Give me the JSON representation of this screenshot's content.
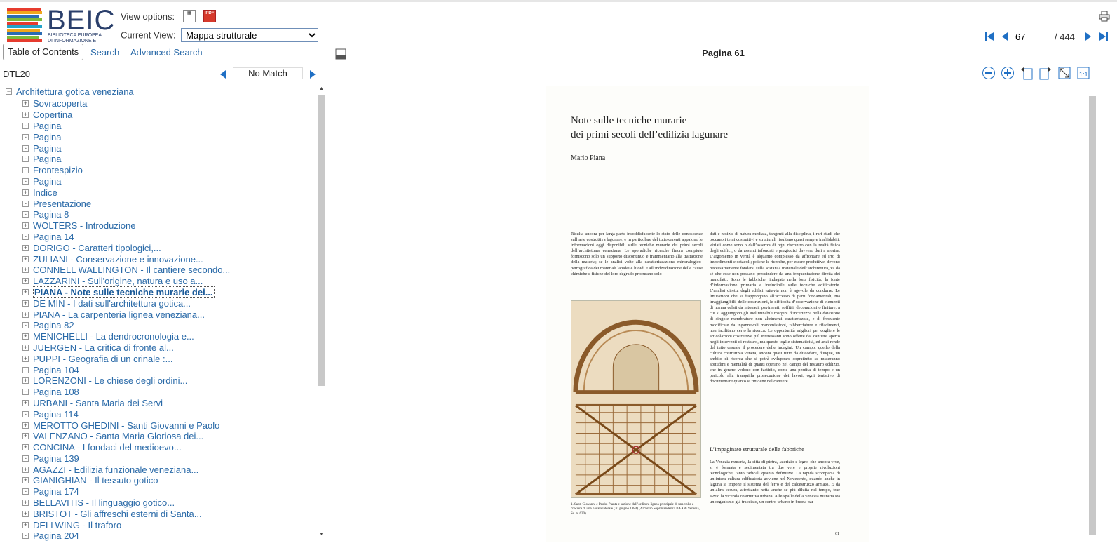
{
  "header": {
    "logo_word": "BEIC",
    "logo_sub_1": "BIBLIOTECA EUROPEA",
    "logo_sub_2": "DI INFORMAZIONE E CULTURA",
    "view_options_label": "View options:",
    "current_view_label": "Current View:",
    "current_view_value": "Mappa strutturale"
  },
  "pager": {
    "current_page": "67",
    "total": "/ 444"
  },
  "tabs": {
    "toc": "Table of Contents",
    "search": "Search",
    "advanced": "Advanced Search"
  },
  "doc_title": "Pagina 61",
  "toc_bar": {
    "id": "DTL20",
    "match": "No Match"
  },
  "tree": {
    "root": "Architettura gotica veneziana",
    "items": [
      {
        "label": "Sovracoperta",
        "exp": "+"
      },
      {
        "label": "Copertina",
        "exp": "+"
      },
      {
        "label": "Pagina",
        "exp": "-"
      },
      {
        "label": "Pagina",
        "exp": "-"
      },
      {
        "label": "Pagina",
        "exp": "-"
      },
      {
        "label": "Pagina",
        "exp": "-"
      },
      {
        "label": "Frontespizio",
        "exp": "-"
      },
      {
        "label": "Pagina",
        "exp": "-"
      },
      {
        "label": "Indice",
        "exp": "+"
      },
      {
        "label": "Presentazione",
        "exp": "-"
      },
      {
        "label": "Pagina 8",
        "exp": "-"
      },
      {
        "label": "WOLTERS - Introduzione",
        "exp": "+"
      },
      {
        "label": "Pagina 14",
        "exp": "-"
      },
      {
        "label": "DORIGO - Caratteri tipologici,...",
        "exp": "+"
      },
      {
        "label": "ZULIANI - Conservazione e innovazione...",
        "exp": "+"
      },
      {
        "label": "CONNELL WALLINGTON - Il cantiere secondo...",
        "exp": "+"
      },
      {
        "label": "LAZZARINI - Sull'origine, natura e uso a...",
        "exp": "+"
      },
      {
        "label": "PIANA - Note sulle tecniche murarie dei...",
        "exp": "+",
        "selected": true
      },
      {
        "label": "DE MIN - I dati sull'architettura gotica...",
        "exp": "+"
      },
      {
        "label": "PIANA - La carpenteria lignea veneziana...",
        "exp": "+"
      },
      {
        "label": "Pagina 82",
        "exp": "-"
      },
      {
        "label": "MENICHELLI - La dendrocronologia e...",
        "exp": "+"
      },
      {
        "label": "JUERGEN - La critica di fronte al...",
        "exp": "+"
      },
      {
        "label": "PUPPI - Geografia di un crinale :...",
        "exp": "+"
      },
      {
        "label": "Pagina 104",
        "exp": "-"
      },
      {
        "label": "LORENZONI - Le chiese degli ordini...",
        "exp": "+"
      },
      {
        "label": "Pagina 108",
        "exp": "-"
      },
      {
        "label": "URBANI - Santa Maria dei Servi",
        "exp": "+"
      },
      {
        "label": "Pagina 114",
        "exp": "-"
      },
      {
        "label": "MEROTTO GHEDINI - Santi Giovanni e Paolo",
        "exp": "+"
      },
      {
        "label": "VALENZANO - Santa Maria Gloriosa dei...",
        "exp": "+"
      },
      {
        "label": "CONCINA - I fondaci del medioevo...",
        "exp": "+"
      },
      {
        "label": "Pagina 139",
        "exp": "-"
      },
      {
        "label": "AGAZZI - Edilizia funzionale veneziana...",
        "exp": "+"
      },
      {
        "label": "GIANIGHIAN - Il tessuto gotico",
        "exp": "+"
      },
      {
        "label": "Pagina 174",
        "exp": "-"
      },
      {
        "label": "BELLAVITIS - Il linguaggio gotico...",
        "exp": "+"
      },
      {
        "label": "BRISTOT - Gli affreschi esterni di Santa...",
        "exp": "+"
      },
      {
        "label": "DELLWING - Il traforo",
        "exp": "+"
      },
      {
        "label": "Pagina 204",
        "exp": "-"
      }
    ]
  },
  "page": {
    "title_line1": "Note sulle tecniche murarie",
    "title_line2": "dei primi secoli dell’edilizia lagunare",
    "author": "Mario Piana",
    "col1": "Risulta ancora per larga parte insoddisfacente lo stato delle conoscenze sull’arte costruttiva lagunare, e in particolare del tutto carenti appaiono le informazioni oggi disponibili sulle tecniche murarie dei primi secoli dell’architettura veneziana. Le sporadiche ricerche finora compiute forniscono solo un supporto discontinuo e frammentario alla trattazione della materia; se le analisi volte alla caratterizzazione mineralogico-petrografica dei materiali lapidei e litoidi e all’individuazione delle cause chimiche e fisiche del loro degrado procurano solo",
    "col2": "dati e notizie di natura mediata, tangenti alla disciplina, i rari studi che toccano i temi costruttivi e strutturali risultano quasi sempre inaffidabili, viziati come sono o dall’assenza di ogni riscontro con la realtà fisica degli edifici, o da assunti infondati e pregiudizi davvero duri a morire. L’argomento in verità è alquanto complesso da affrontare ed irto di impedimenti e ostacoli; poiché le ricerche, per essere produttive, devono necessariamente fondarsi sulla sostanza materiale dell’architettura, va da sé che esse non possano prescindere da una frequentazione diretta dei manufatti. Sono le fabbriche, indagate nella loro fisicità, la fonte d’informazione primaria e ineludibile sulle tecniche edificatorie. L’analisi diretta degli edifici tuttavia non è agevole da condurre. Le limitazioni che si frappongono all’accesso di parti fondamentali, ma irraggiungibili, delle costruzioni, le difficoltà d’osservazione di elementi di norma celati da intonaci, pavimenti, soffitti, decorazioni o finiture, a cui si aggiungono gli ineliminabili margini d’incertezza nella datazione di singole membrature non altrimenti caratterizzate, e di frequente modificate da ingannevoli manomissioni, rabberciature e rifacimenti, non facilitano certo la ricerca. Le opportunità migliori per cogliere le articolazioni costruttive più interessanti sono offerte dal cantiere aperto negli interventi di restauro, ma questo toglie sistematicità, ed anzi rende del tutto casuale il procedere delle indagini. Un campo, quello della cultura costruttiva veneta, ancora quasi tutto da dissodare, dunque, un ambito di ricerca che si potrà sviluppare soprattutto se muteranno abitudini e mentalità di quanti operano nel campo del restauro edilizio, che in genere vedono con fastidio, come una perdita di tempo e un pericolo alla tranquilla prosecuzione dei lavori, ogni tentativo di documentare quanto si rinviene nel cantiere.",
    "heading2": "L’impaginato strutturale delle fabbriche",
    "col3": "La Venezia muraria, la città di pietra, laterizio e legno che ancora vive, si è formata e sedimentata tra due vere e proprie rivoluzioni tecnologiche, tanto radicali quanto definitive. La rapida scomparsa di un’intera cultura edificatoria avviene nel Novecento, quando anche in laguna si impone il sistema del ferro e del calcestruzzo armato. E da un’altra cesura, altrettanto netta anche se più diluita nel tempo, trae avvio la vicenda costruttiva urbana. Alle spalle della Venezia muraria sta un organismo già tracciato, un centro urbano in buona par-",
    "caption": "1. Santi Giovanni e Paolo. Pianta e sezione dell’orditura lignea principale di una volta a crociera di una navata laterale (20 giugno 1884) (Archivio Soprintendenza BAA di Venezia, Sc. n. 630).",
    "page_number": "61"
  },
  "colors": {
    "link": "#2a6aa8",
    "logo_text": "#2a3f6b",
    "nav_blue": "#1f6fc4"
  }
}
